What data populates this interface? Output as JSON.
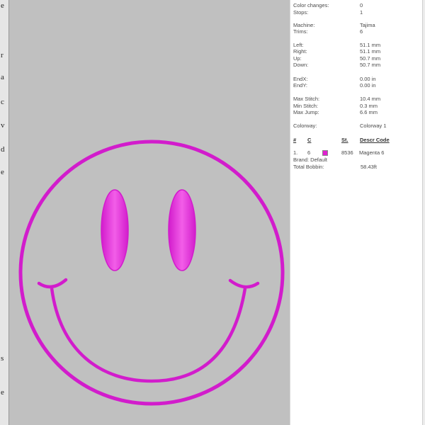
{
  "left_strip": {
    "letters": [
      "e",
      "r",
      "a",
      "c",
      "v",
      "d",
      "e",
      "s",
      "e"
    ]
  },
  "stats": [
    {
      "label": "Color changes:",
      "value": "0"
    },
    {
      "label": "Stops:",
      "value": "1"
    },
    {
      "label": "Machine:",
      "value": "Tajima"
    },
    {
      "label": "Trims:",
      "value": "6"
    },
    {
      "label": "Left:",
      "value": "51.1 mm"
    },
    {
      "label": "Right:",
      "value": "51.1 mm"
    },
    {
      "label": "Up:",
      "value": "50.7 mm"
    },
    {
      "label": "Down:",
      "value": "50.7 mm"
    },
    {
      "label": "EndX:",
      "value": "0.00 in"
    },
    {
      "label": "EndY:",
      "value": "0.00 in"
    },
    {
      "label": "Max Stitch:",
      "value": "10.4 mm"
    },
    {
      "label": "Min Stitch:",
      "value": "0.3 mm"
    },
    {
      "label": "Max Jump:",
      "value": "6.6 mm"
    },
    {
      "label": "Colorway:",
      "value": "Colorway 1"
    }
  ],
  "thread_table": {
    "headers": {
      "num": "#",
      "color": "C",
      "stitches": "St.",
      "descr_code": "Descr Code"
    },
    "rows": [
      {
        "num": "1.",
        "color_num": "6",
        "swatch": "#e020d0",
        "stitches": "8536",
        "descr": "Magenta 6"
      }
    ],
    "brand": "Brand: Default",
    "total_bobbin_label": "Total Bobbin:",
    "total_bobbin_value": "58.43ft"
  },
  "colors": {
    "thread": "#d21ccc",
    "thread_highlight": "#f25ee8",
    "canvas_bg": "#c0c0c0"
  }
}
